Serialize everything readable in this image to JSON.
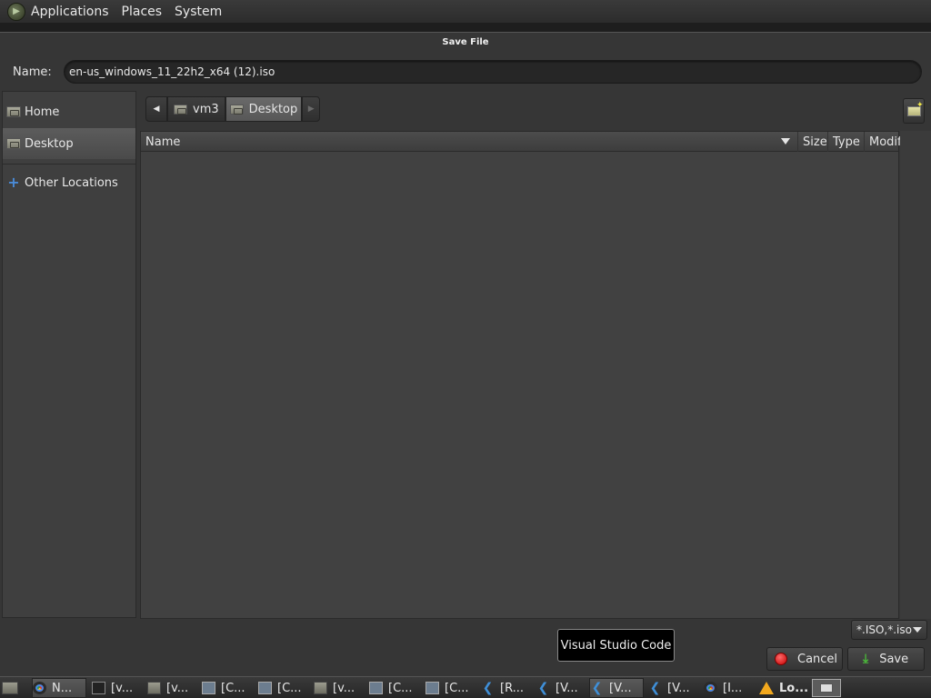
{
  "top_panel": {
    "menus": [
      "Applications",
      "Places",
      "System"
    ]
  },
  "dialog": {
    "title": "Save File",
    "name_label": "Name:",
    "name_value": "en-us_windows_11_22h2_x64 (12).iso"
  },
  "sidebar": {
    "places": [
      {
        "label": "Home",
        "icon": "home-folder-icon"
      },
      {
        "label": "Desktop",
        "icon": "desktop-folder-icon",
        "selected": true
      },
      {
        "label": "Other Locations",
        "icon": "plus-icon"
      }
    ]
  },
  "path_bar": {
    "segments": [
      "vm3",
      "Desktop"
    ]
  },
  "file_list": {
    "columns": [
      "Name",
      "Size",
      "Type",
      "Modif"
    ],
    "rows": []
  },
  "filter": {
    "selected": "*.ISO,*.iso"
  },
  "buttons": {
    "cancel": "Cancel",
    "save": "Save"
  },
  "tooltip": {
    "text": "Visual Studio Code"
  },
  "taskbar": {
    "tasks": [
      {
        "label": "N...",
        "icon": "chrome-icon",
        "active": true
      },
      {
        "label": "[v...",
        "icon": "terminal-icon"
      },
      {
        "label": "[v...",
        "icon": "folder-icon"
      },
      {
        "label": "[C...",
        "icon": "monitor-icon"
      },
      {
        "label": "[C...",
        "icon": "monitor-icon"
      },
      {
        "label": "[v...",
        "icon": "folder-icon"
      },
      {
        "label": "[C...",
        "icon": "monitor-icon"
      },
      {
        "label": "[C...",
        "icon": "monitor-icon"
      },
      {
        "label": "[R...",
        "icon": "vscode-icon"
      },
      {
        "label": "[V...",
        "icon": "vscode-icon"
      },
      {
        "label": "[V...",
        "icon": "vscode-icon",
        "active": true
      },
      {
        "label": "[V...",
        "icon": "vscode-icon"
      },
      {
        "label": "[I...",
        "icon": "chrome-icon"
      },
      {
        "label": "Lo...",
        "icon": "warning-icon",
        "bold": true
      }
    ]
  }
}
